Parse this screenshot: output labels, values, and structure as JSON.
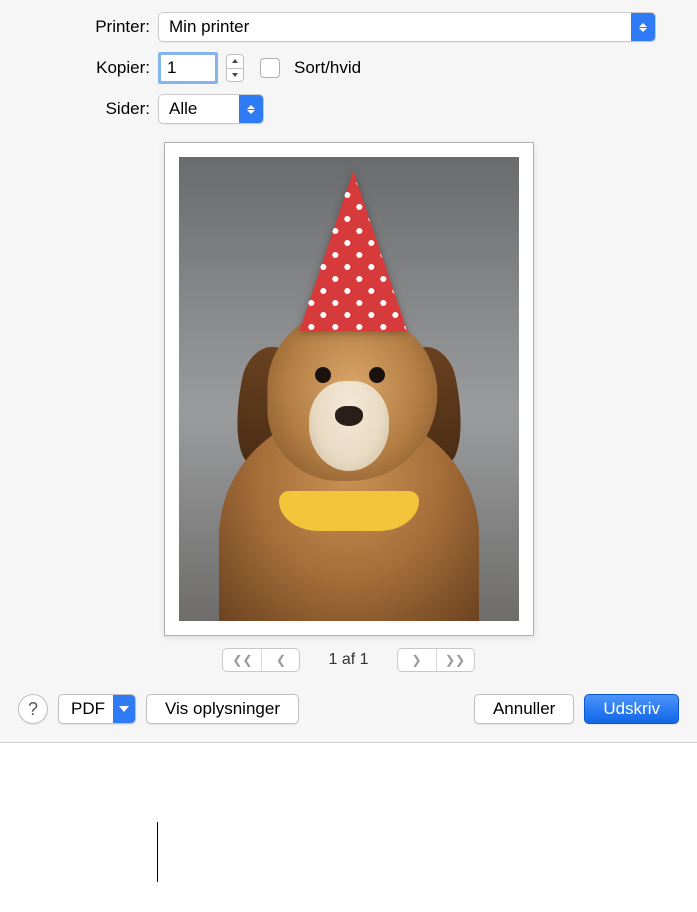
{
  "labels": {
    "printer": "Printer:",
    "copies": "Kopier:",
    "pages": "Sider:",
    "bw": "Sort/hvid"
  },
  "printer": {
    "selected": "Min printer"
  },
  "copies": {
    "value": "1"
  },
  "pages": {
    "selected": "Alle"
  },
  "preview": {
    "page_indicator": "1 af 1"
  },
  "buttons": {
    "help": "?",
    "pdf": "PDF",
    "details": "Vis oplysninger",
    "cancel": "Annuller",
    "print": "Udskriv"
  },
  "icons": {
    "first": "❮❮",
    "prev": "❮",
    "next": "❯",
    "last": "❯❯"
  }
}
